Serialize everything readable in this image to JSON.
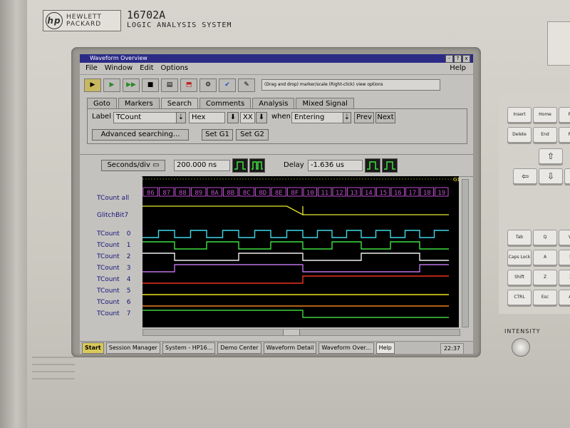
{
  "device": {
    "brand_line1": "HEWLETT",
    "brand_line2": "PACKARD",
    "brand_mark": "hp",
    "model": "16702A",
    "subtitle": "LOGIC ANALYSIS SYSTEM",
    "intensity_label": "INTENSITY"
  },
  "window": {
    "title": "Waveform Overview",
    "controls": [
      "-",
      "?",
      "x"
    ],
    "menu": [
      "File",
      "Window",
      "Edit",
      "Options"
    ],
    "help": "Help"
  },
  "toolbar": {
    "message": "(Drag and drop) marker/scale (Right-click) view options",
    "icons": [
      "arrow-icon",
      "run-icon",
      "run-repetitive-icon",
      "stop-icon",
      "listing-icon",
      "probe-icon",
      "config-icon",
      "check-icon",
      "edit-icon"
    ]
  },
  "tabs": [
    "Goto",
    "Markers",
    "Search",
    "Comments",
    "Analysis",
    "Mixed Signal"
  ],
  "active_tab": "Search",
  "search": {
    "label_text": "Label",
    "label_value": "TCount",
    "format": "Hex",
    "value": "XX",
    "when_text": "when",
    "when_value": "Entering",
    "prev": "Prev",
    "next": "Next",
    "advanced": "Advanced searching...",
    "set_g1": "Set G1",
    "set_g2": "Set G2"
  },
  "timebase": {
    "mode": "Seconds/div",
    "seconds_div": "200.000 ns",
    "delay_label": "Delay",
    "delay": "-1.636 us"
  },
  "waveform": {
    "marker": "G1",
    "bus_label": "TCount all",
    "bus_values": [
      "86",
      "87",
      "88",
      "89",
      "8A",
      "8B",
      "8C",
      "8D",
      "8E",
      "8F",
      "10",
      "11",
      "12",
      "13",
      "14",
      "15",
      "16",
      "17",
      "18",
      "19"
    ],
    "signals": [
      {
        "name": "GlitchBit7",
        "color": "#e8e830"
      },
      {
        "name": "TCount",
        "bit": "0",
        "color": "#40d8e8"
      },
      {
        "name": "TCount",
        "bit": "1",
        "color": "#40e040"
      },
      {
        "name": "TCount",
        "bit": "2",
        "color": "#f0f0f0"
      },
      {
        "name": "TCount",
        "bit": "3",
        "color": "#c070e8"
      },
      {
        "name": "TCount",
        "bit": "4",
        "color": "#f03020"
      },
      {
        "name": "TCount",
        "bit": "5",
        "color": "#f0e020"
      },
      {
        "name": "TCount",
        "bit": "6",
        "color": "#f08020"
      },
      {
        "name": "TCount",
        "bit": "7",
        "color": "#40d040"
      }
    ]
  },
  "taskbar": {
    "start": "Start",
    "items": [
      "Session Manager",
      "System - HP16...",
      "Demo Center",
      "Waveform Detail",
      "Waveform Over...",
      "Help"
    ],
    "clock": "22:37"
  },
  "keys": [
    "Insert",
    "Home",
    "Pa",
    "Delete",
    "End",
    "Pa",
    "Tab",
    "Q",
    "W",
    "Caps Lock",
    "A",
    "S",
    "Shift",
    "Z",
    "X",
    "CTRL",
    "Esc",
    "Al"
  ]
}
